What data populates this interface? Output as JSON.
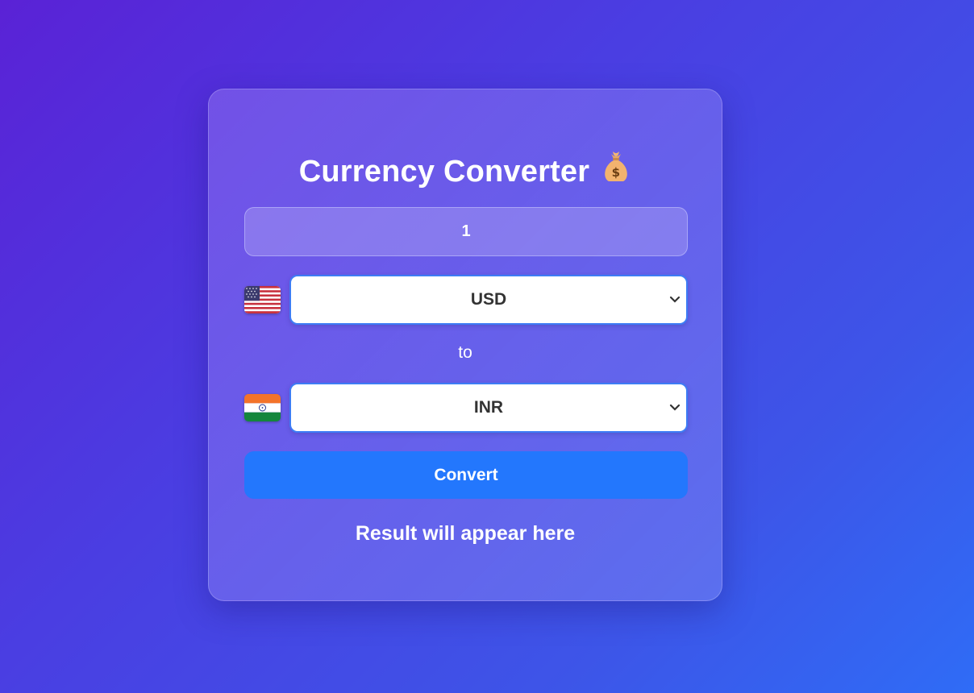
{
  "converter": {
    "title": "Currency Converter",
    "title_icon": "money-bag-icon",
    "amount_value": "1",
    "from": {
      "currency": "USD",
      "flag_icon": "us-flag-icon"
    },
    "to_label": "to",
    "to": {
      "currency": "INR",
      "flag_icon": "india-flag-icon"
    },
    "convert_label": "Convert",
    "result_text": "Result will appear here"
  },
  "colors": {
    "button": "#2377fd",
    "select_border": "#3d7cf5",
    "background_start": "#5a22d6",
    "background_end": "#2f6cf6"
  }
}
